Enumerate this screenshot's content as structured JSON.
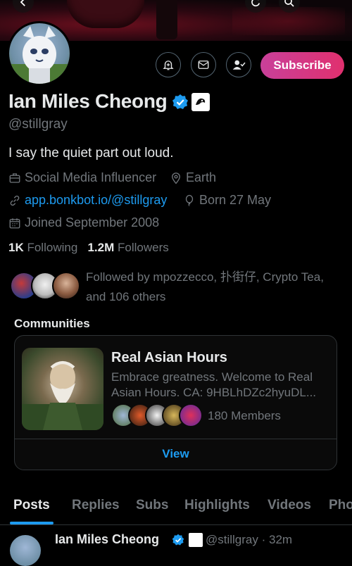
{
  "profile": {
    "name": "Ian Miles Cheong",
    "handle": "@stillgray",
    "bio": "I say the quiet part out loud.",
    "category": "Social Media Influencer",
    "location": "Earth",
    "website": "app.bonkbot.io/@stillgray",
    "born": "Born 27 May",
    "joined": "Joined September 2008",
    "following_count": "1K",
    "following_label": "Following",
    "followers_count": "1.2M",
    "followers_label": "Followers",
    "followed_by_line1": "Followed by mpozzecco, 扑街仔, Crypto Tea,",
    "followed_by_line2": "and 106 others"
  },
  "actions": {
    "subscribe_label": "Subscribe"
  },
  "communities": {
    "title": "Communities",
    "card": {
      "name": "Real Asian Hours",
      "description_line1": "Embrace greatness. Welcome to Real",
      "description_line2": "Asian Hours. CA: 9HBLhDZc2hyuDL...",
      "members": "180 Members",
      "view_label": "View"
    }
  },
  "tabs": [
    "Posts",
    "Replies",
    "Subs",
    "Highlights",
    "Videos",
    "Pho"
  ],
  "active_tab": "Posts",
  "post_preview": {
    "name": "Ian Miles Cheong",
    "handle_time": "@stillgray · 32m"
  },
  "colors": {
    "accent": "#1d9bf0",
    "subscribe_gradient_start": "#c9409a",
    "subscribe_gradient_end": "#e0306e",
    "text_primary": "#e7e9ea",
    "text_secondary": "#71767b"
  }
}
